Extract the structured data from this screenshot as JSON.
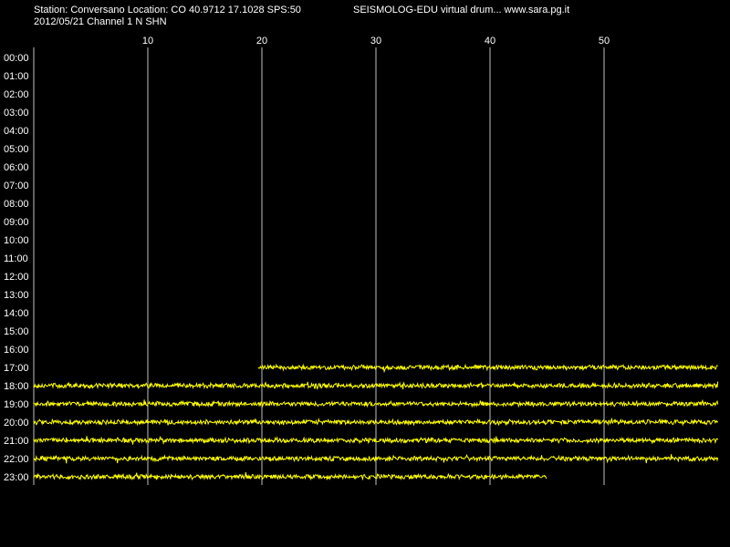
{
  "header": {
    "station_line": "Station: Conversano Location: CO 40.9712 17.1028 SPS:50",
    "app_line": "SEISMOLOG-EDU virtual drum... www.sara.pg.it",
    "date_line": "2012/05/21  Channel 1 N SHN"
  },
  "colors": {
    "background": "#000000",
    "trace": "#ffff00",
    "grid": "#c0c0c0",
    "text": "#ffffff"
  },
  "chart_data": {
    "type": "line",
    "title": "SEISMOLOG-EDU virtual drum... www.sara.pg.it",
    "xlabel": "",
    "ylabel": "",
    "x_ticks": [
      10,
      20,
      30,
      40,
      50
    ],
    "xlim": [
      0,
      60
    ],
    "y_ticks": [
      "00:00",
      "01:00",
      "02:00",
      "03:00",
      "04:00",
      "05:00",
      "06:00",
      "07:00",
      "08:00",
      "09:00",
      "10:00",
      "11:00",
      "12:00",
      "13:00",
      "14:00",
      "15:00",
      "16:00",
      "17:00",
      "18:00",
      "19:00",
      "20:00",
      "21:00",
      "22:00",
      "23:00"
    ],
    "grid": "vertical",
    "series": [
      {
        "hour": "17:00",
        "start_min": 19.7,
        "end_min": 60
      },
      {
        "hour": "18:00",
        "start_min": 0,
        "end_min": 60
      },
      {
        "hour": "19:00",
        "start_min": 0,
        "end_min": 60
      },
      {
        "hour": "20:00",
        "start_min": 0,
        "end_min": 60
      },
      {
        "hour": "21:00",
        "start_min": 0,
        "end_min": 60
      },
      {
        "hour": "22:00",
        "start_min": 0,
        "end_min": 60
      },
      {
        "hour": "23:00",
        "start_min": 0,
        "end_min": 45
      }
    ]
  }
}
